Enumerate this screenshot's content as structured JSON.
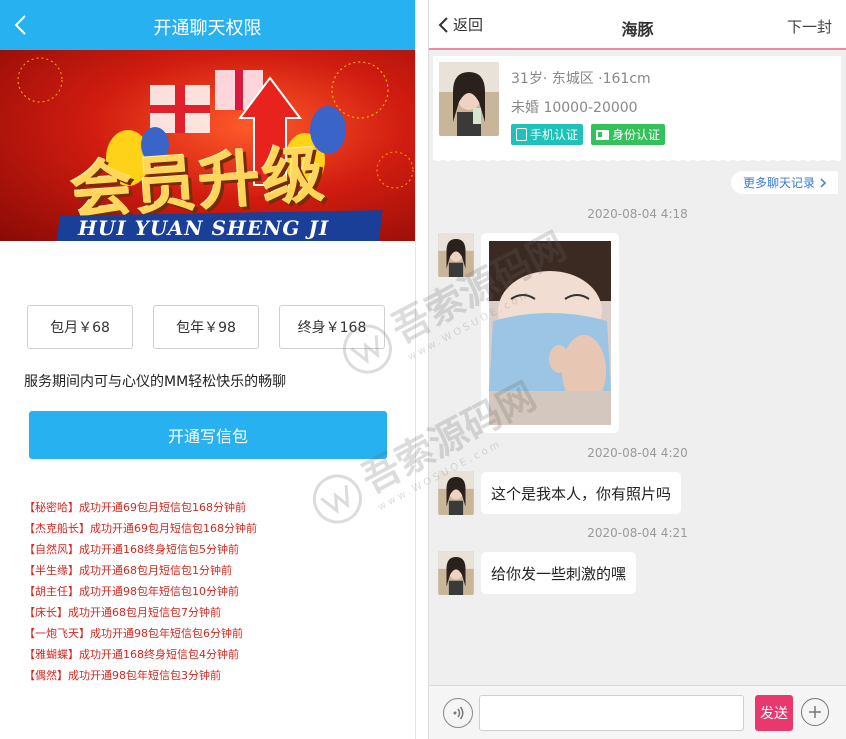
{
  "left": {
    "title": "开通聊天权限",
    "banner": {
      "title": "会员升级",
      "pinyin": "HUI  YUAN  SHENG  JI"
    },
    "plans": [
      {
        "label": "包月￥68"
      },
      {
        "label": "包年￥98"
      },
      {
        "label": "终身￥168"
      }
    ],
    "description": "服务期间内可与心仪的MM轻松快乐的畅聊",
    "open_button": "开通写信包",
    "feed": [
      "【秘密哈】成功开通69包月短信包168分钟前",
      "【杰克船长】成功开通69包月短信包168分钟前",
      "【自然风】成功开通168终身短信包5分钟前",
      "【半生缘】成功开通68包月短信包1分钟前",
      "【胡主任】成功开通98包年短信包10分钟前",
      "【床长】成功开通68包月短信包7分钟前",
      "【一炮飞天】成功开通98包年短信包6分钟前",
      "【雅蝴蝶】成功开通168终身短信包4分钟前",
      "【偶然】成功开通98包年短信包3分钟前"
    ]
  },
  "right": {
    "header": {
      "back_label": "返回",
      "title": "海豚",
      "next_label": "下一封"
    },
    "profile": {
      "line1": "31岁· 东城区 ·161cm",
      "line2": "未婚 10000-20000",
      "badge_phone": "手机认证",
      "badge_id": "身份认证"
    },
    "more_history": "更多聊天记录",
    "messages": [
      {
        "time": "2020-08-04 4:18",
        "type": "image"
      },
      {
        "time": "2020-08-04 4:20",
        "type": "text",
        "text": "这个是我本人，你有照片吗"
      },
      {
        "time": "2020-08-04 4:21",
        "type": "text",
        "text": "给你发一些刺激的嘿"
      }
    ],
    "input": {
      "placeholder": "",
      "send_label": "发送"
    }
  },
  "watermark": {
    "text": "吾索源码网",
    "domain": "www.WOSUOE.com"
  },
  "colors": {
    "primary": "#27b1f0",
    "accent": "#e8386d",
    "feed_red": "#d6261e",
    "badge_phone": "#1ec2b8",
    "badge_id": "#34c15c"
  }
}
